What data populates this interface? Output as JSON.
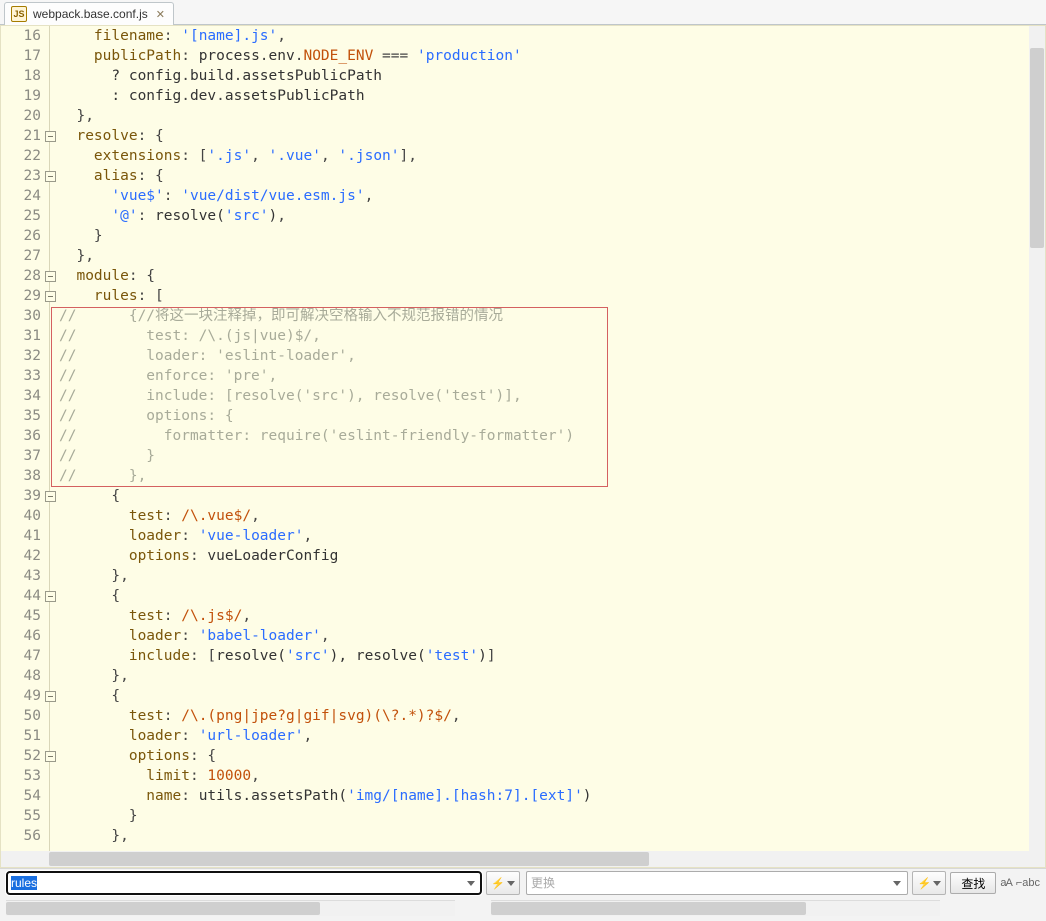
{
  "tab": {
    "filename": "webpack.base.conf.js"
  },
  "search": {
    "find_text": "rules",
    "replace_placeholder": "更换",
    "find_btn_label": "查找"
  },
  "gutter_start": 16,
  "fold_lines": [
    21,
    23,
    28,
    29,
    39,
    44,
    49,
    52
  ],
  "code_lines": [
    {
      "n": 16,
      "seg": [
        [
          "prop",
          "    filename"
        ],
        [
          "pun",
          ": "
        ],
        [
          "str",
          "'[name].js'"
        ],
        [
          "pun",
          ","
        ]
      ]
    },
    {
      "n": 17,
      "seg": [
        [
          "prop",
          "    publicPath"
        ],
        [
          "pun",
          ": "
        ],
        [
          "id",
          "process"
        ],
        [
          "pun",
          "."
        ],
        [
          "id",
          "env"
        ],
        [
          "pun",
          "."
        ],
        [
          "mem",
          "NODE_ENV"
        ],
        [
          "pun",
          " === "
        ],
        [
          "str",
          "'production'"
        ]
      ]
    },
    {
      "n": 18,
      "seg": [
        [
          "id",
          "      ? config"
        ],
        [
          "pun",
          "."
        ],
        [
          "id",
          "build"
        ],
        [
          "pun",
          "."
        ],
        [
          "id",
          "assetsPublicPath"
        ]
      ]
    },
    {
      "n": 19,
      "seg": [
        [
          "id",
          "      : config"
        ],
        [
          "pun",
          "."
        ],
        [
          "id",
          "dev"
        ],
        [
          "pun",
          "."
        ],
        [
          "id",
          "assetsPublicPath"
        ]
      ]
    },
    {
      "n": 20,
      "seg": [
        [
          "pun",
          "  },"
        ]
      ]
    },
    {
      "n": 21,
      "seg": [
        [
          "prop",
          "  resolve"
        ],
        [
          "pun",
          ": {"
        ]
      ]
    },
    {
      "n": 22,
      "seg": [
        [
          "prop",
          "    extensions"
        ],
        [
          "pun",
          ": ["
        ],
        [
          "str",
          "'.js'"
        ],
        [
          "pun",
          ", "
        ],
        [
          "str",
          "'.vue'"
        ],
        [
          "pun",
          ", "
        ],
        [
          "str",
          "'.json'"
        ],
        [
          "pun",
          "],"
        ]
      ]
    },
    {
      "n": 23,
      "seg": [
        [
          "prop",
          "    alias"
        ],
        [
          "pun",
          ": {"
        ]
      ]
    },
    {
      "n": 24,
      "seg": [
        [
          "str",
          "      'vue$'"
        ],
        [
          "pun",
          ": "
        ],
        [
          "str",
          "'vue/dist/vue.esm.js'"
        ],
        [
          "pun",
          ","
        ]
      ]
    },
    {
      "n": 25,
      "seg": [
        [
          "str",
          "      '@'"
        ],
        [
          "pun",
          ": "
        ],
        [
          "id",
          "resolve("
        ],
        [
          "str",
          "'src'"
        ],
        [
          "id",
          ")"
        ],
        [
          "pun",
          ","
        ]
      ]
    },
    {
      "n": 26,
      "seg": [
        [
          "pun",
          "    }"
        ]
      ]
    },
    {
      "n": 27,
      "seg": [
        [
          "pun",
          "  },"
        ]
      ]
    },
    {
      "n": 28,
      "seg": [
        [
          "prop",
          "  module"
        ],
        [
          "pun",
          ": {"
        ]
      ]
    },
    {
      "n": 29,
      "seg": [
        [
          "prop",
          "    rules"
        ],
        [
          "pun",
          ": ["
        ]
      ]
    },
    {
      "n": 30,
      "seg": [
        [
          "cmt",
          "//      {//将这一块注释掉，即可解决空格输入不规范报错的情况"
        ]
      ]
    },
    {
      "n": 31,
      "seg": [
        [
          "cmt",
          "//        test: /\\.(js|vue)$/,"
        ]
      ]
    },
    {
      "n": 32,
      "seg": [
        [
          "cmt",
          "//        loader: 'eslint-loader',"
        ]
      ]
    },
    {
      "n": 33,
      "seg": [
        [
          "cmt",
          "//        enforce: 'pre',"
        ]
      ]
    },
    {
      "n": 34,
      "seg": [
        [
          "cmt",
          "//        include: [resolve('src'), resolve('test')],"
        ]
      ]
    },
    {
      "n": 35,
      "seg": [
        [
          "cmt",
          "//        options: {"
        ]
      ]
    },
    {
      "n": 36,
      "seg": [
        [
          "cmt",
          "//          formatter: require('eslint-friendly-formatter')"
        ]
      ]
    },
    {
      "n": 37,
      "seg": [
        [
          "cmt",
          "//        }"
        ]
      ]
    },
    {
      "n": 38,
      "seg": [
        [
          "cmt",
          "//      },"
        ]
      ]
    },
    {
      "n": 39,
      "seg": [
        [
          "pun",
          "      {"
        ]
      ]
    },
    {
      "n": 40,
      "seg": [
        [
          "prop",
          "        test"
        ],
        [
          "pun",
          ": "
        ],
        [
          "rgx",
          "/\\.vue$/"
        ],
        [
          "pun",
          ","
        ]
      ]
    },
    {
      "n": 41,
      "seg": [
        [
          "prop",
          "        loader"
        ],
        [
          "pun",
          ": "
        ],
        [
          "str",
          "'vue-loader'"
        ],
        [
          "pun",
          ","
        ]
      ]
    },
    {
      "n": 42,
      "seg": [
        [
          "prop",
          "        options"
        ],
        [
          "pun",
          ": "
        ],
        [
          "id",
          "vueLoaderConfig"
        ]
      ]
    },
    {
      "n": 43,
      "seg": [
        [
          "pun",
          "      },"
        ]
      ]
    },
    {
      "n": 44,
      "seg": [
        [
          "pun",
          "      {"
        ]
      ]
    },
    {
      "n": 45,
      "seg": [
        [
          "prop",
          "        test"
        ],
        [
          "pun",
          ": "
        ],
        [
          "rgx",
          "/\\.js$/"
        ],
        [
          "pun",
          ","
        ]
      ]
    },
    {
      "n": 46,
      "seg": [
        [
          "prop",
          "        loader"
        ],
        [
          "pun",
          ": "
        ],
        [
          "str",
          "'babel-loader'"
        ],
        [
          "pun",
          ","
        ]
      ]
    },
    {
      "n": 47,
      "seg": [
        [
          "prop",
          "        include"
        ],
        [
          "pun",
          ": ["
        ],
        [
          "id",
          "resolve("
        ],
        [
          "str",
          "'src'"
        ],
        [
          "id",
          "), resolve("
        ],
        [
          "str",
          "'test'"
        ],
        [
          "id",
          ")"
        ],
        [
          "pun",
          "]"
        ]
      ]
    },
    {
      "n": 48,
      "seg": [
        [
          "pun",
          "      },"
        ]
      ]
    },
    {
      "n": 49,
      "seg": [
        [
          "pun",
          "      {"
        ]
      ]
    },
    {
      "n": 50,
      "seg": [
        [
          "prop",
          "        test"
        ],
        [
          "pun",
          ": "
        ],
        [
          "rgx",
          "/\\.(png|jpe?g|gif|svg)(\\?.*)?$/"
        ],
        [
          "pun",
          ","
        ]
      ]
    },
    {
      "n": 51,
      "seg": [
        [
          "prop",
          "        loader"
        ],
        [
          "pun",
          ": "
        ],
        [
          "str",
          "'url-loader'"
        ],
        [
          "pun",
          ","
        ]
      ]
    },
    {
      "n": 52,
      "seg": [
        [
          "prop",
          "        options"
        ],
        [
          "pun",
          ": {"
        ]
      ]
    },
    {
      "n": 53,
      "seg": [
        [
          "prop",
          "          limit"
        ],
        [
          "pun",
          ": "
        ],
        [
          "num",
          "10000"
        ],
        [
          "pun",
          ","
        ]
      ]
    },
    {
      "n": 54,
      "seg": [
        [
          "prop",
          "          name"
        ],
        [
          "pun",
          ": "
        ],
        [
          "id",
          "utils.assetsPath("
        ],
        [
          "str",
          "'img/[name].[hash:7].[ext]'"
        ],
        [
          "id",
          ")"
        ]
      ]
    },
    {
      "n": 55,
      "seg": [
        [
          "pun",
          "        }"
        ]
      ]
    },
    {
      "n": 56,
      "seg": [
        [
          "pun",
          "      },"
        ]
      ]
    }
  ],
  "highlight": {
    "from_line": 30,
    "to_line": 38
  }
}
